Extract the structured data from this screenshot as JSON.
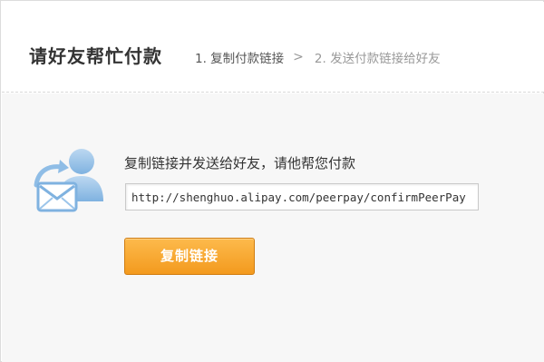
{
  "header": {
    "title": "请好友帮忙付款",
    "steps": [
      {
        "label": "1. 复制付款链接"
      },
      {
        "label": "2. 发送付款链接给好友"
      }
    ],
    "separator": ">"
  },
  "main": {
    "instruction": "复制链接并发送给好友，请他帮您付款",
    "link_value": "http://shenghuo.alipay.com/peerpay/confirmPeerPay",
    "copy_button_label": "复制链接",
    "icon": "share-envelope-icon"
  },
  "colors": {
    "button": "#f39a1e",
    "icon_blue": "#7fb2e0",
    "background": "#f7f7f7"
  }
}
